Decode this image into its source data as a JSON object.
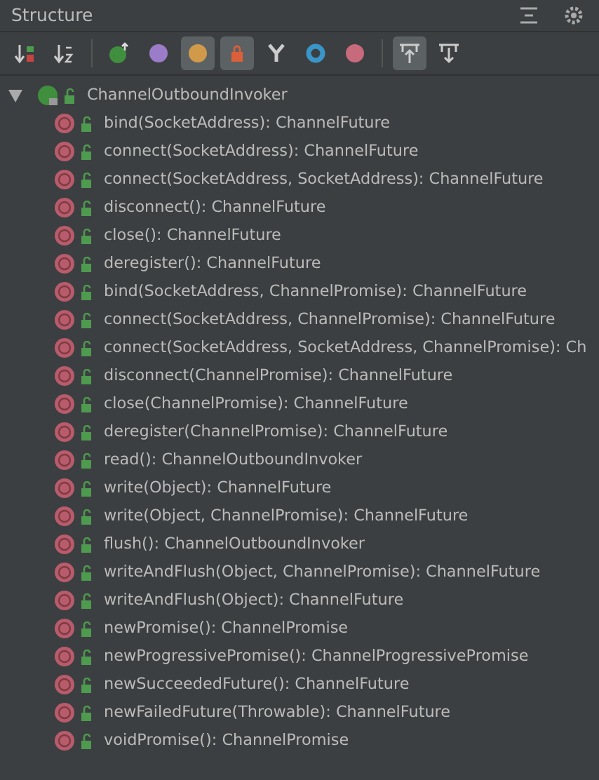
{
  "panel": {
    "title": "Structure"
  },
  "toolbar": [
    {
      "kind": "sort-visibility",
      "selected": false
    },
    {
      "kind": "sort-alpha",
      "selected": false
    },
    {
      "kind": "inherited",
      "selected": false
    },
    {
      "kind": "properties",
      "selected": false
    },
    {
      "kind": "fields",
      "selected": true
    },
    {
      "kind": "non-public",
      "selected": true
    },
    {
      "kind": "anonymous",
      "selected": false
    },
    {
      "kind": "circle",
      "selected": false
    },
    {
      "kind": "lambdas",
      "selected": false
    },
    {
      "kind": "scroll-to-source",
      "selected": true
    },
    {
      "kind": "scroll-from-source",
      "selected": false
    }
  ],
  "tree": {
    "label": "ChannelOutboundInvoker",
    "expanded": true,
    "children": [
      {
        "label": "bind(SocketAddress): ChannelFuture"
      },
      {
        "label": "connect(SocketAddress): ChannelFuture"
      },
      {
        "label": "connect(SocketAddress, SocketAddress): ChannelFuture"
      },
      {
        "label": "disconnect(): ChannelFuture"
      },
      {
        "label": "close(): ChannelFuture"
      },
      {
        "label": "deregister(): ChannelFuture"
      },
      {
        "label": "bind(SocketAddress, ChannelPromise): ChannelFuture"
      },
      {
        "label": "connect(SocketAddress, ChannelPromise): ChannelFuture"
      },
      {
        "label": "connect(SocketAddress, SocketAddress, ChannelPromise): Ch"
      },
      {
        "label": "disconnect(ChannelPromise): ChannelFuture"
      },
      {
        "label": "close(ChannelPromise): ChannelFuture"
      },
      {
        "label": "deregister(ChannelPromise): ChannelFuture"
      },
      {
        "label": "read(): ChannelOutboundInvoker"
      },
      {
        "label": "write(Object): ChannelFuture"
      },
      {
        "label": "write(Object, ChannelPromise): ChannelFuture"
      },
      {
        "label": "flush(): ChannelOutboundInvoker"
      },
      {
        "label": "writeAndFlush(Object, ChannelPromise): ChannelFuture"
      },
      {
        "label": "writeAndFlush(Object): ChannelFuture"
      },
      {
        "label": "newPromise(): ChannelPromise"
      },
      {
        "label": "newProgressivePromise(): ChannelProgressivePromise"
      },
      {
        "label": "newSucceededFuture(): ChannelFuture"
      },
      {
        "label": "newFailedFuture(Throwable): ChannelFuture"
      },
      {
        "label": "voidPromise(): ChannelPromise"
      }
    ]
  }
}
